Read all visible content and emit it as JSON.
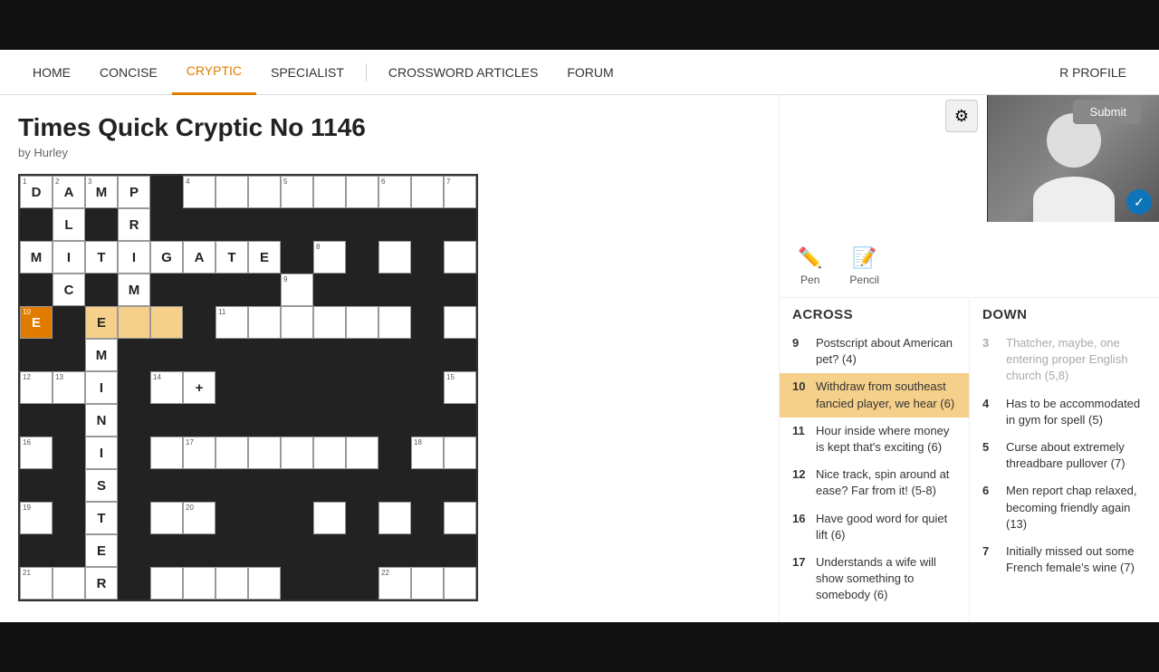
{
  "nav": {
    "items": [
      {
        "label": "HOME",
        "active": false
      },
      {
        "label": "CONCISE",
        "active": false
      },
      {
        "label": "CRYPTIC",
        "active": true
      },
      {
        "label": "SPECIALIST",
        "active": false
      },
      {
        "label": "CROSSWORD ARTICLES",
        "active": false
      },
      {
        "label": "FORUM",
        "active": false
      }
    ],
    "profile_label": "R PROFILE"
  },
  "puzzle": {
    "title": "Times Quick Cryptic No 1146",
    "by": "by Hurley"
  },
  "tools": {
    "pen_label": "Pen",
    "pencil_label": "Pencil",
    "submit_label": "Submit"
  },
  "clues": {
    "across_header": "ACROSS",
    "down_header": "DOWN",
    "across_items": [
      {
        "num": "9",
        "text": "Postscript about American pet? (4)",
        "active": false
      },
      {
        "num": "10",
        "text": "Withdraw from southeast fancied player, we hear (6)",
        "active": true
      },
      {
        "num": "11",
        "text": "Hour inside where money is kept that's exciting (6)",
        "active": false
      },
      {
        "num": "12",
        "text": "Nice track, spin around at ease? Far from it! (5-8)",
        "active": false
      },
      {
        "num": "16",
        "text": "Have good word for quiet lift (6)",
        "active": false
      },
      {
        "num": "17",
        "text": "Understands a wife will show something to somebody (6)",
        "active": false
      }
    ],
    "down_items": [
      {
        "num": "3",
        "text": "Thatcher, maybe, one entering proper English church (5,8)",
        "active": false,
        "greyed": true
      },
      {
        "num": "4",
        "text": "Has to be accommodated in gym for spell (5)",
        "active": false
      },
      {
        "num": "5",
        "text": "Curse about extremely threadbare pullover (7)",
        "active": false
      },
      {
        "num": "6",
        "text": "Men report chap relaxed, becoming friendly again (13)",
        "active": false
      },
      {
        "num": "7",
        "text": "Initially missed out some French female's wine (7)",
        "active": false
      }
    ]
  },
  "grid": {
    "active_clue_row": 4,
    "active_clue_col_start": 0,
    "active_clue_col_end": 2,
    "active_orange_col": 0
  }
}
